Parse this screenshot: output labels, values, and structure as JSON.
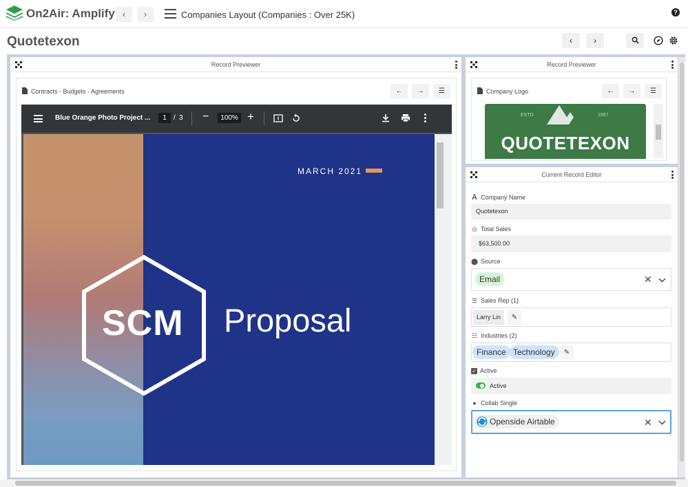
{
  "app": {
    "brand": "On2Air: Amplify",
    "layout_title": "Companies Layout  (Companies : Over 25K)"
  },
  "page": {
    "title": "Quotetexon"
  },
  "left_panel": {
    "header": "Record Previewer",
    "attachment_field": "Contracts - Budgets - Agreements",
    "pdf": {
      "file_name": "Blue Orange Photo Project ...",
      "page_current": "1",
      "page_sep": "/",
      "page_total": "3",
      "zoom": "100%",
      "slide": {
        "date": "MARCH 2021",
        "logo_text": "SCM",
        "heading": "Proposal"
      }
    }
  },
  "right_top_panel": {
    "header": "Record Previewer",
    "attachment_field": "Company Logo",
    "logo": {
      "estd": "ESTD",
      "year": "1987",
      "name": "QUOTETEXON"
    }
  },
  "editor": {
    "header": "Current Record Editor",
    "fields": {
      "company_name": {
        "label": "Company Name",
        "value": "Quotetexon"
      },
      "total_sales": {
        "label": "Total Sales",
        "value": "$63,500.00"
      },
      "source": {
        "label": "Source",
        "value": "Email"
      },
      "sales_rep": {
        "label": "Sales Rep (1)",
        "value": "Larry Lin"
      },
      "industries": {
        "label": "Industries (2)",
        "values": [
          "Finance",
          "Technology"
        ]
      },
      "active": {
        "label": "Active",
        "value": "Active",
        "checked": true
      },
      "collab": {
        "label": "Collab Single",
        "value": "Openside Airtable"
      }
    }
  },
  "colors": {
    "brand_green": "#2e9e48",
    "workspace_bg": "#c6d1df",
    "pdf_page_blue": "#1f3488",
    "chip_green": "#d6f5d6",
    "chip_blue": "#cfe4fb",
    "focus_blue": "#5aa0e8",
    "logo_green": "#3d7a46"
  }
}
